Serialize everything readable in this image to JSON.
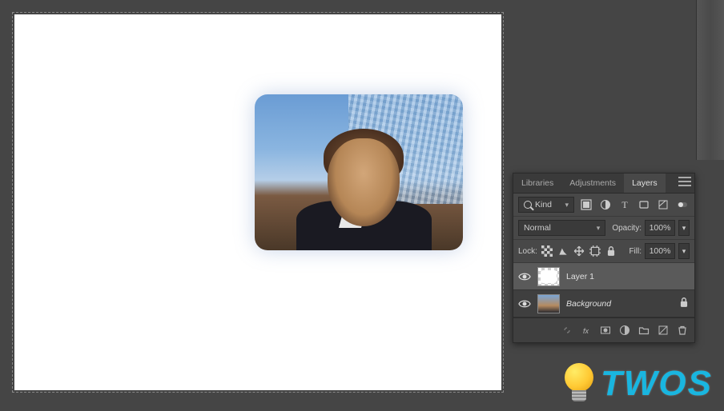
{
  "panel": {
    "tabs": {
      "libraries": "Libraries",
      "adjustments": "Adjustments",
      "layers": "Layers"
    },
    "activeTab": "Layers",
    "filter": {
      "label": "Kind"
    },
    "blend": {
      "mode": "Normal",
      "opacityLabel": "Opacity:",
      "opacityValue": "100%"
    },
    "lock": {
      "label": "Lock:",
      "fillLabel": "Fill:",
      "fillValue": "100%"
    },
    "layers": [
      {
        "name": "Layer 1",
        "italic": false,
        "selected": true,
        "locked": false,
        "thumb": "checker"
      },
      {
        "name": "Background",
        "italic": true,
        "selected": false,
        "locked": true,
        "thumb": "bg"
      }
    ]
  },
  "watermark": {
    "text": "TWOS"
  }
}
